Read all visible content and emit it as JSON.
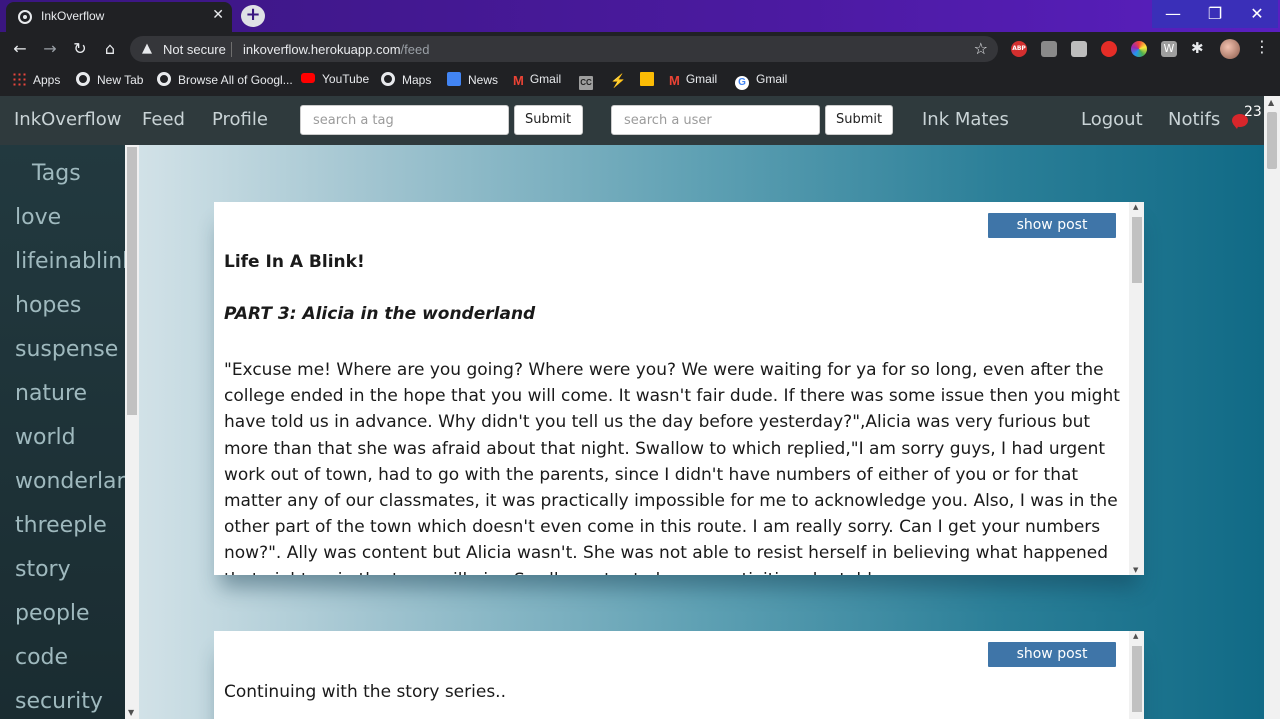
{
  "browser": {
    "tab_title": "InkOverflow",
    "tab_close": "✕",
    "new_tab": "+",
    "window_controls": [
      "—",
      "❐",
      "✕"
    ],
    "nav_icons": [
      "back-icon",
      "forward-icon",
      "reload-icon",
      "home-icon"
    ],
    "security_label": "Not secure",
    "url_host": "inkoverflow.herokuapp.com",
    "url_path": "/feed",
    "bookmarks": [
      {
        "label": "Apps",
        "icon": "apps-grid-icon",
        "color": "#e8453c"
      },
      {
        "label": "New Tab",
        "icon": "chrome-icon",
        "color": "#e8eaed"
      },
      {
        "label": "Browse All of Googl...",
        "icon": "chrome-icon",
        "color": "#e8eaed"
      },
      {
        "label": "YouTube",
        "icon": "youtube-icon",
        "color": "#ff0000"
      },
      {
        "label": "Maps",
        "icon": "chrome-icon",
        "color": "#e8eaed"
      },
      {
        "label": "News",
        "icon": "news-icon",
        "color": "#4285f4"
      },
      {
        "label": "Gmail",
        "icon": "gmail-icon",
        "color": "#ea4335"
      },
      {
        "label": "",
        "icon": "cc-icon",
        "color": "#9e9e9e"
      },
      {
        "label": "",
        "icon": "bolt-icon",
        "color": "#f4b400"
      },
      {
        "label": "",
        "icon": "image-icon",
        "color": "#fbbc05"
      },
      {
        "label": "Gmail",
        "icon": "gmail-icon",
        "color": "#ea4335"
      },
      {
        "label": "Gmail",
        "icon": "google-icon",
        "color": "#4285f4"
      }
    ]
  },
  "navbar": {
    "brand": "InkOverflow",
    "feed": "Feed",
    "profile": "Profile",
    "tag_placeholder": "search a tag",
    "tag_submit": "Submit",
    "user_placeholder": "search a user",
    "user_submit": "Submit",
    "ink_mates": "Ink Mates",
    "logout": "Logout",
    "notifs": "Notifs",
    "notif_count": "23"
  },
  "sidebar": {
    "title": "Tags",
    "tags": [
      "love",
      "lifeinablink",
      "hopes",
      "suspense",
      "nature",
      "world",
      "wonderland",
      "threeple",
      "story",
      "people",
      "code",
      "security"
    ]
  },
  "posts": [
    {
      "button": "show post",
      "title": "Life In A Blink!",
      "part": "PART 3: Alicia in the wonderland",
      "body": "\"Excuse me! Where are you going? Where were you? We were waiting for ya for so long, even after the college ended in the hope that you will come. It wasn't fair dude. If there was some issue then you might have told us in advance. Why didn't you tell us the day before yesterday?\",Alicia was very furious but more than that she was afraid about that night. Swallow to which replied,\"I am sorry guys, I had urgent work out of town, had to go with the parents, since I didn't have numbers of either of you or for that matter any of our classmates, it was practically impossible for me to acknowledge you. Also, I was in the other part of the town which doesn't even come in this route. I am really sorry. Can I get your numbers now?\". Ally was content but Alicia wasn't. She was not able to resist herself in believing what happened that night as in the town will give Swallow a try to know a activities she told"
    },
    {
      "button": "show post",
      "body": "Continuing with the story series.."
    }
  ]
}
